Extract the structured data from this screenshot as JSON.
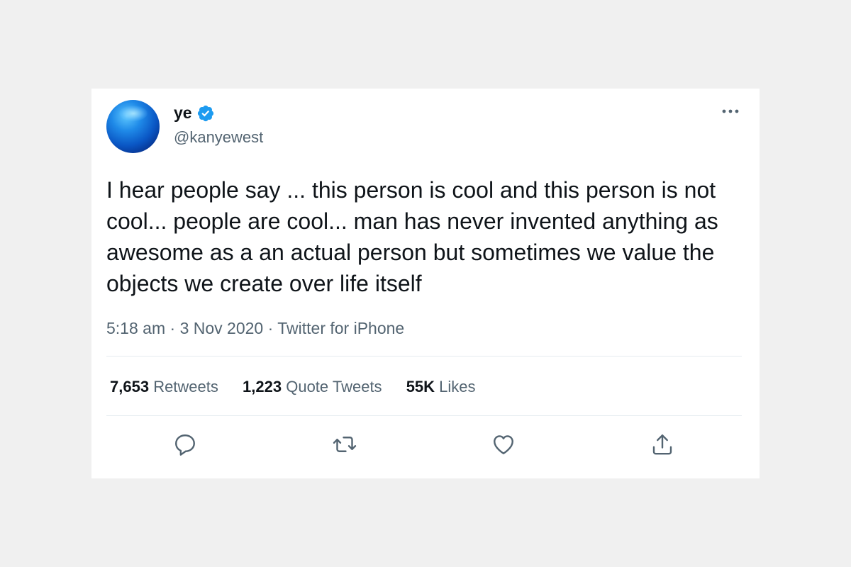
{
  "user": {
    "display_name": "ye",
    "handle": "@kanyewest",
    "verified_icon": "verified-badge-icon",
    "avatar_colors": [
      "#5ec8ff",
      "#0a56c4",
      "#041f63"
    ]
  },
  "tweet": {
    "text": "I hear people say ... this person is cool and this person is not cool... people are cool... man has never invented anything as awesome as a an actual person but sometimes we value the objects we create over life itself",
    "time": "5:18 am",
    "date": "3 Nov 2020",
    "source": "Twitter for iPhone",
    "separator": "·"
  },
  "stats": {
    "retweets_count": "7,653",
    "retweets_label": "Retweets",
    "quotes_count": "1,223",
    "quotes_label": "Quote Tweets",
    "likes_count": "55K",
    "likes_label": "Likes"
  },
  "actions": {
    "reply_icon": "reply-icon",
    "retweet_icon": "retweet-icon",
    "like_icon": "heart-icon",
    "share_icon": "share-icon",
    "more_icon": "more-icon"
  },
  "colors": {
    "text_primary": "#0f1419",
    "text_secondary": "#536471",
    "verified_blue": "#1d9bf0",
    "background": "#f0f0f0",
    "card": "#ffffff"
  }
}
